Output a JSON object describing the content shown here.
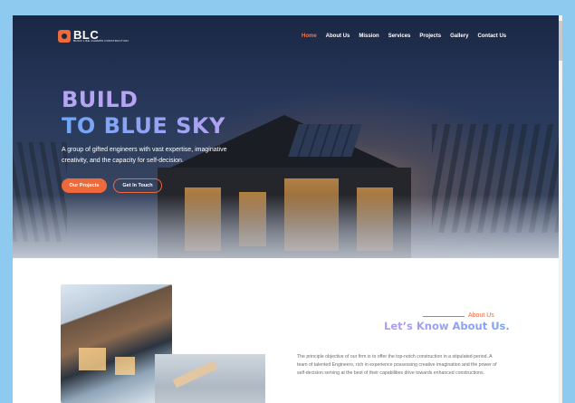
{
  "brand": {
    "name": "BLC",
    "tagline": "BUILD LIKE CHAMPS CONSTRUCTION"
  },
  "nav": {
    "items": [
      {
        "label": "Home",
        "active": true
      },
      {
        "label": "About Us"
      },
      {
        "label": "Mission"
      },
      {
        "label": "Services"
      },
      {
        "label": "Projects"
      },
      {
        "label": "Gallery"
      },
      {
        "label": "Contact Us"
      }
    ]
  },
  "hero": {
    "title_line1": "BUILD",
    "title_line2": "TO BLUE SKY",
    "subtitle": "A group of gifted engineers with vast expertise, imaginative creativity, and the capacity for self-decision.",
    "primary_button": "Our Projects",
    "secondary_button": "Get In Touch"
  },
  "about": {
    "kicker": "About Us",
    "title": "Let’s Know About Us.",
    "body": "The principle objective of our firm is to offer the top-notch construction in a stipulated period. A team of talented Engineers, rich in experience possessing creative imagination and the power of self-decision serving at the best of their capabilities drive towards enhanced constructions."
  },
  "colors": {
    "accent": "#ee6a3a",
    "gradient_start": "#b09cf0",
    "gradient_end": "#7aa4f3",
    "page_bg": "#8ec9ef"
  }
}
